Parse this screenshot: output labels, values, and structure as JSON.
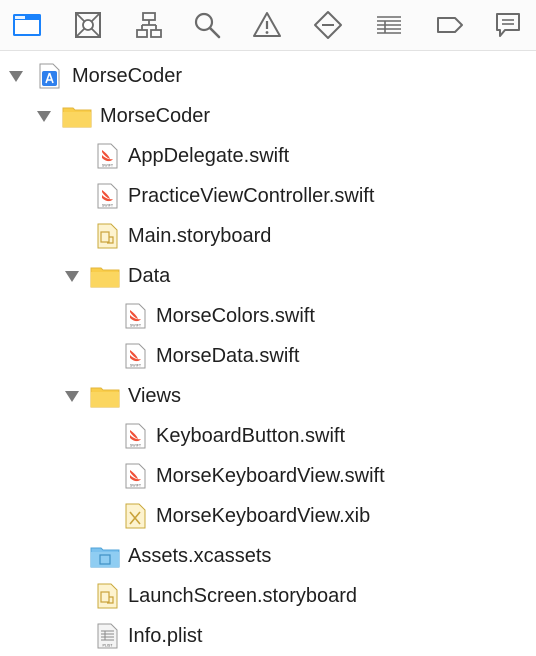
{
  "toolbar": {
    "icons": [
      {
        "name": "project-navigator-icon",
        "active": true
      },
      {
        "name": "source-control-icon"
      },
      {
        "name": "symbol-navigator-icon"
      },
      {
        "name": "find-icon"
      },
      {
        "name": "issue-warning-icon"
      },
      {
        "name": "test-icon"
      },
      {
        "name": "debug-navigator-icon"
      },
      {
        "name": "breakpoint-icon"
      },
      {
        "name": "report-icon"
      }
    ],
    "active_color": "#1a82fb",
    "icon_color": "#6b6b6b"
  },
  "tree": {
    "root": {
      "label": "MorseCoder",
      "type": "project",
      "expanded": true
    },
    "group_main": {
      "label": "MorseCoder",
      "type": "folder",
      "expanded": true
    },
    "file_appdelegate": {
      "label": "AppDelegate.swift",
      "type": "swift"
    },
    "file_practice": {
      "label": "PracticeViewController.swift",
      "type": "swift"
    },
    "file_main": {
      "label": "Main.storyboard",
      "type": "storyboard"
    },
    "group_data": {
      "label": "Data",
      "type": "folder",
      "expanded": true
    },
    "file_colors": {
      "label": "MorseColors.swift",
      "type": "swift"
    },
    "file_data": {
      "label": "MorseData.swift",
      "type": "swift"
    },
    "group_views": {
      "label": "Views",
      "type": "folder",
      "expanded": true
    },
    "file_keybutton": {
      "label": "KeyboardButton.swift",
      "type": "swift"
    },
    "file_keyview": {
      "label": "MorseKeyboardView.swift",
      "type": "swift"
    },
    "file_keyxib": {
      "label": "MorseKeyboardView.xib",
      "type": "xib"
    },
    "file_assets": {
      "label": "Assets.xcassets",
      "type": "assets"
    },
    "file_launch": {
      "label": "LaunchScreen.storyboard",
      "type": "storyboard"
    },
    "file_info": {
      "label": "Info.plist",
      "type": "plist"
    }
  },
  "icon_labels": {
    "swift": "SWIFT",
    "plist": "PLIST"
  },
  "colors": {
    "folder": "#f9cd4a",
    "folder_dark": "#e8b93a",
    "assets_folder": "#7cc2ee",
    "swift_red": "#f05138",
    "disclosure": "#7a7a7a"
  }
}
